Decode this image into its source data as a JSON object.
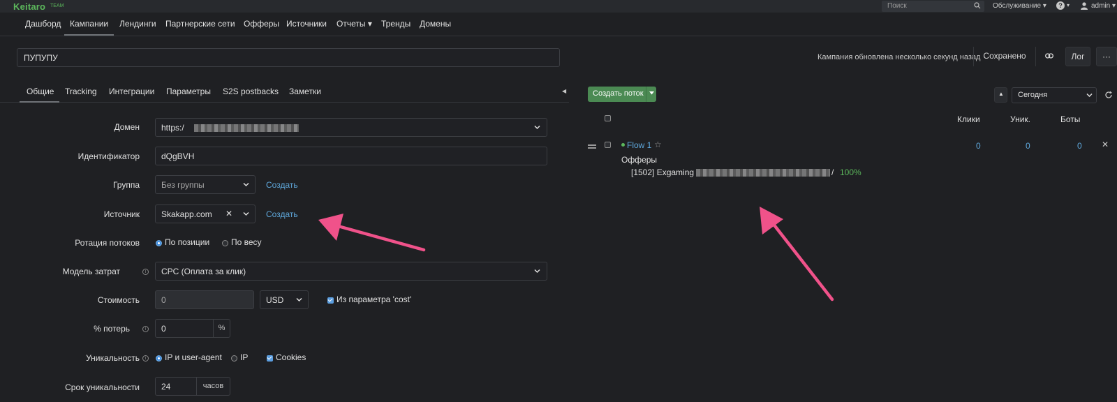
{
  "brand": {
    "logo": "Keitaro",
    "edition": "TEAM"
  },
  "topbar": {
    "search_placeholder": "Поиск",
    "service_menu": "Обслуживание ▾",
    "help_caret": "▾",
    "help_glyph": "?",
    "user": "admin ▾"
  },
  "nav": {
    "items": [
      "Дашборд",
      "Кампании",
      "Лендинги",
      "Партнерские сети",
      "Офферы",
      "Источники",
      "Отчеты ▾",
      "Тренды",
      "Домены"
    ],
    "active": "Кампании"
  },
  "campaign": {
    "name": "ПУПУПУ",
    "status_text": "Кампания обновлена несколько секунд назад",
    "saved_label": "Сохранено",
    "log_label": "Лог",
    "more_label": "···"
  },
  "tabs": [
    "Общие",
    "Tracking",
    "Интеграции",
    "Параметры",
    "S2S postbacks",
    "Заметки"
  ],
  "active_tab": "Общие",
  "form": {
    "domain": {
      "label": "Домен",
      "value_prefix": "https:/"
    },
    "identifier": {
      "label": "Идентификатор",
      "value": "dQgBVH"
    },
    "group": {
      "label": "Группа",
      "value": "Без группы",
      "create_link": "Создать"
    },
    "source": {
      "label": "Источник",
      "value": "Skakapp.com",
      "clear": "✕",
      "create_link": "Создать"
    },
    "rotation": {
      "label": "Ротация потоков",
      "options": [
        "По позиции",
        "По весу"
      ],
      "selected": "По позиции"
    },
    "cost_model": {
      "label": "Модель затрат",
      "value": "CPC (Оплата за клик)"
    },
    "cost": {
      "label": "Стоимость",
      "value": "0",
      "currency": "USD",
      "from_param_label": "Из параметра 'cost'",
      "from_param_checked": true
    },
    "loss": {
      "label": "% потерь",
      "value": "0",
      "unit": "%"
    },
    "uniqueness": {
      "label": "Уникальность",
      "options": [
        "IP и user-agent",
        "IP"
      ],
      "selected": "IP и user-agent",
      "cookies_label": "Cookies",
      "cookies_checked": true
    },
    "uniqueness_period": {
      "label": "Срок уникальности",
      "value": "24",
      "unit": "часов"
    }
  },
  "flows_panel": {
    "create_button": "Создать поток",
    "sort_glyph": "▲",
    "period": "Сегодня",
    "columns": [
      "Клики",
      "Уник.",
      "Боты"
    ],
    "flows": [
      {
        "name": "Flow 1",
        "star": "☆",
        "clicks": "0",
        "unique": "0",
        "bots": "0",
        "remove": "✕",
        "offers_title": "Офферы",
        "offer_label": "[1502] Exgaming",
        "offer_slash": "/",
        "offer_share": "100%"
      }
    ]
  },
  "colors": {
    "accent_green": "#5cb85c",
    "link_blue": "#5fa8dc",
    "annotation_pink": "#f0528a",
    "background": "#1f2023"
  }
}
